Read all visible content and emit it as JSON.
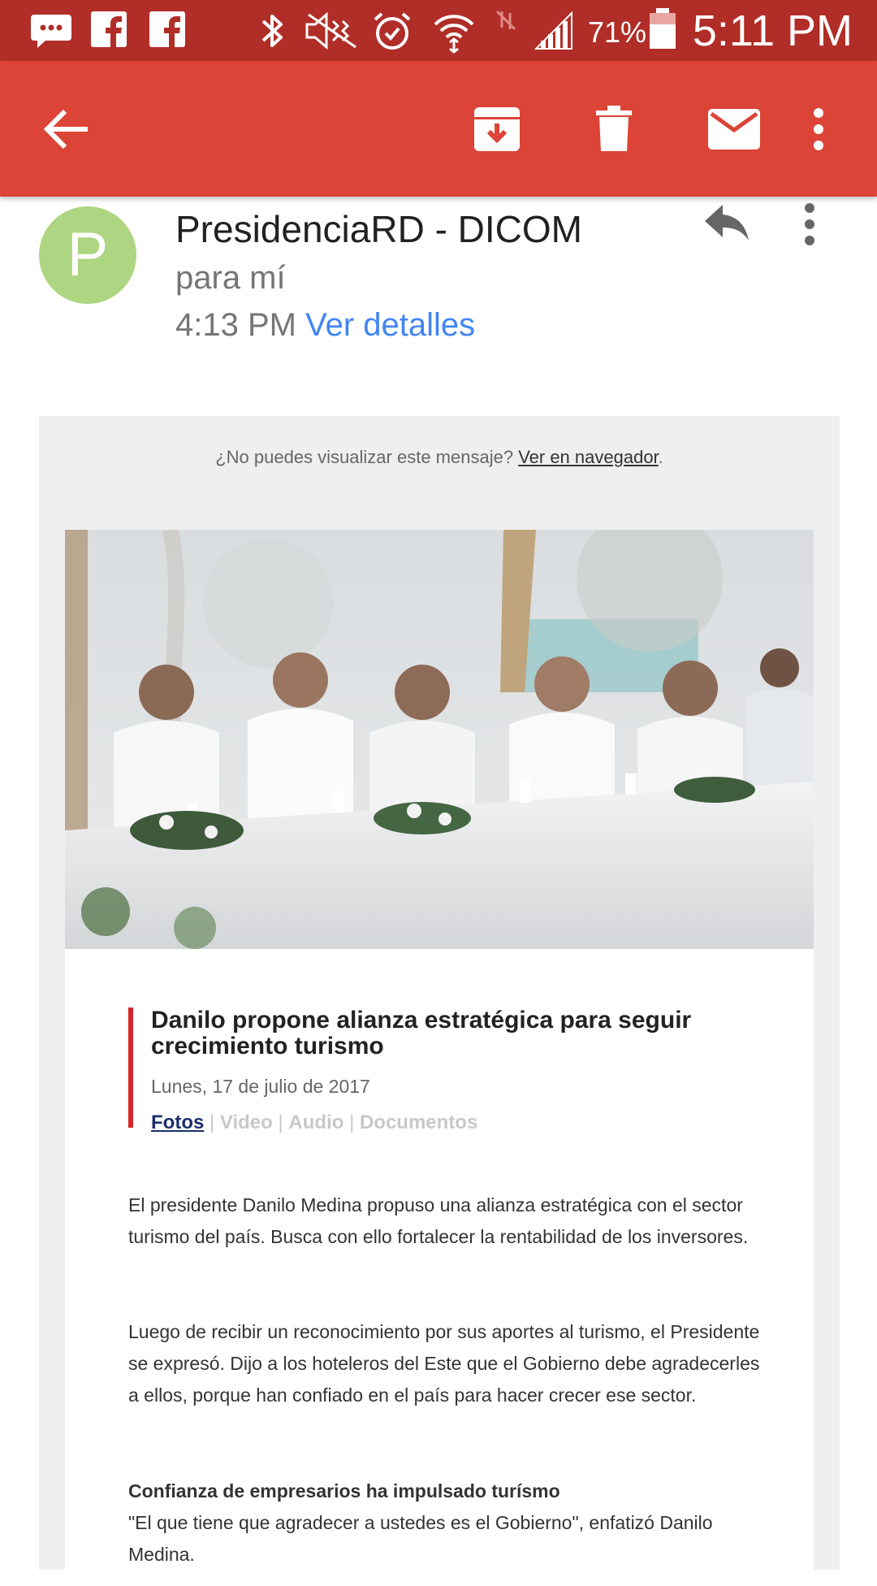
{
  "status_bar": {
    "battery_percent": "71%",
    "time": "5:11 PM",
    "icons": [
      "message-icon",
      "facebook-icon",
      "facebook-icon",
      "bluetooth-icon",
      "mute-icon",
      "alarm-icon",
      "wifi-icon",
      "no-data-icon",
      "signal-icon",
      "battery-icon"
    ]
  },
  "app_bar": {
    "icons": [
      "back-arrow-icon",
      "archive-icon",
      "delete-icon",
      "mark-unread-icon",
      "more-vert-icon"
    ],
    "color": "#db4437"
  },
  "email": {
    "avatar_letter": "P",
    "avatar_color": "#aed581",
    "sender": "PresidenciaRD - DICOM",
    "recipient": "para mí",
    "time": "4:13 PM",
    "details_link": "Ver detalles"
  },
  "message": {
    "cant_view_text": "¿No puedes visualizar este mensaje?",
    "browser_link": "Ver en navegador",
    "browser_link_suffix": ".",
    "headline": "Danilo propone alianza estratégica para seguir crecimiento turismo",
    "date": "Lunes, 17 de julio de 2017",
    "media_links": [
      "Fotos",
      "Video",
      "Audio",
      "Documentos"
    ],
    "paragraph_1": "El presidente Danilo Medina propuso una alianza estratégica con el sector turismo del país. Busca con ello fortalecer la rentabilidad de los inversores.",
    "paragraph_2": "Luego de recibir un reconocimiento por sus aportes al turismo, el Presidente se expresó. Dijo a los hoteleros del Este que el Gobierno debe agradecerles a ellos, porque han confiado en el país para hacer crecer ese sector.",
    "subheading": "Confianza de empresarios ha impulsado turísmo",
    "paragraph_3": "\"El que tiene que agradecer a ustedes es el Gobierno\", enfatizó Danilo Medina."
  }
}
